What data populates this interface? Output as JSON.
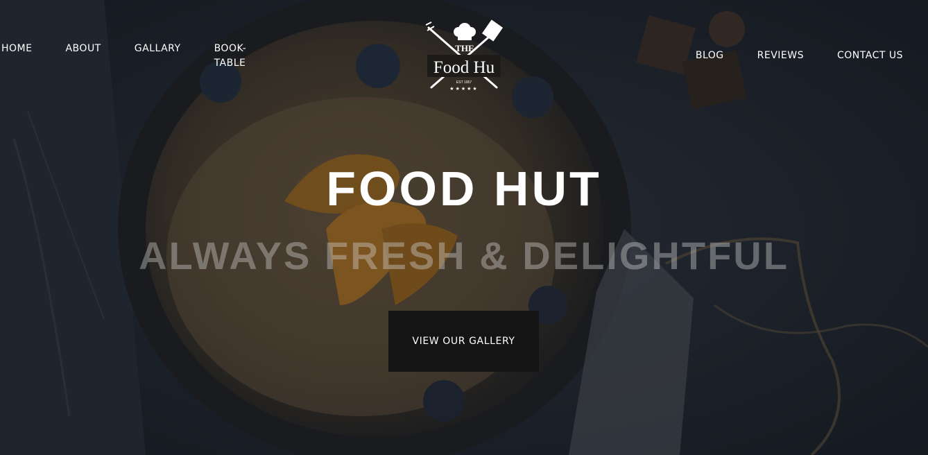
{
  "nav": {
    "left": [
      "HOME",
      "ABOUT",
      "GALLARY",
      "BOOK-TABLE"
    ],
    "right": [
      "BLOG",
      "REVIEWS",
      "CONTACT US"
    ]
  },
  "logo": {
    "top": "THE",
    "name": "Food Hu",
    "est": "EST 1957",
    "stars": "★★★★★"
  },
  "hero": {
    "title": "FOOD HUT",
    "subtitle": "ALWAYS FRESH & DELIGHTFUL",
    "button": "VIEW OUR GALLERY"
  },
  "colors": {
    "text": "#ffffff",
    "button_bg": "#141414",
    "subtitle": "#8a8a8a",
    "background": "#1d232c"
  }
}
